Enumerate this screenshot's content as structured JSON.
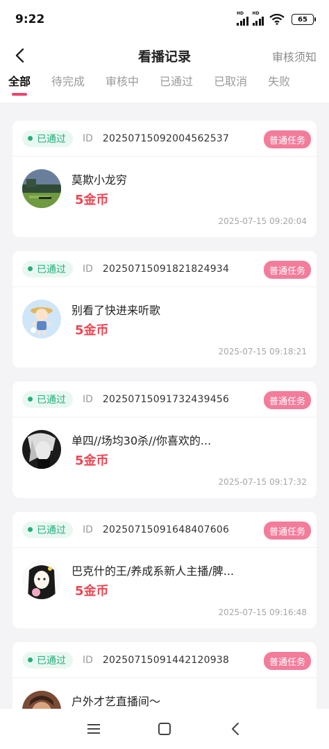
{
  "status_bar": {
    "time": "9:22",
    "signal1_label": "HD",
    "signal2_label": "HD",
    "battery": "65"
  },
  "header": {
    "title": "看播记录",
    "notice_link": "审核须知",
    "back_icon": "chevron-left-icon"
  },
  "tabs": [
    {
      "label": "全部",
      "active": true
    },
    {
      "label": "待完成"
    },
    {
      "label": "审核中"
    },
    {
      "label": "已通过"
    },
    {
      "label": "已取消"
    },
    {
      "label": "失败"
    }
  ],
  "accent_color": "#f0436b",
  "records": [
    {
      "status": "已通过",
      "id_label": "ID",
      "id": "20250715092004562537",
      "task_type": "普通任务",
      "streamer": "莫欺小龙穷",
      "reward": "5金币",
      "time": "2025-07-15 09:20:04"
    },
    {
      "status": "已通过",
      "id_label": "ID",
      "id": "20250715091821824934",
      "task_type": "普通任务",
      "streamer": "别看了快进来听歌",
      "reward": "5金币",
      "time": "2025-07-15 09:18:21"
    },
    {
      "status": "已通过",
      "id_label": "ID",
      "id": "20250715091732439456",
      "task_type": "普通任务",
      "streamer": "单四//场均30杀//你喜欢的...",
      "reward": "5金币",
      "time": "2025-07-15 09:17:32"
    },
    {
      "status": "已通过",
      "id_label": "ID",
      "id": "20250715091648407606",
      "task_type": "普通任务",
      "streamer": "巴克什的王/养成系新人主播/脾...",
      "reward": "5金币",
      "time": "2025-07-15 09:16:48"
    },
    {
      "status": "已通过",
      "id_label": "ID",
      "id": "20250715091442120938",
      "task_type": "普通任务",
      "streamer": "户外才艺直播间～",
      "reward": "",
      "time": ""
    }
  ],
  "bottom_nav": {
    "menu_icon": "menu-icon",
    "home_icon": "home-square-icon",
    "back_icon": "back-triangle-icon"
  }
}
